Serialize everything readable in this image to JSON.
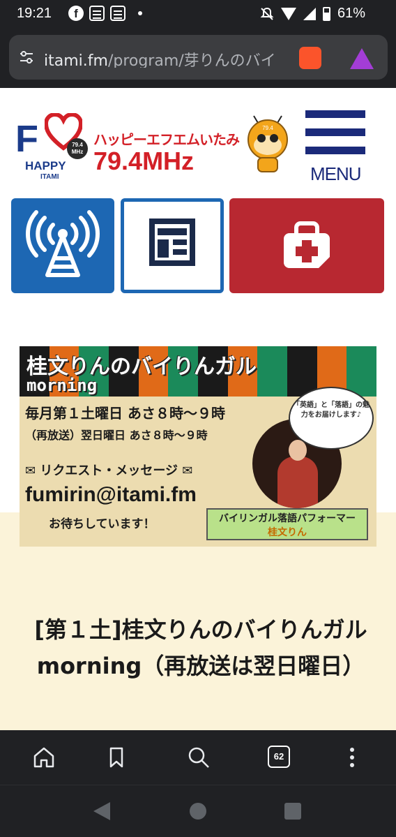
{
  "status": {
    "time": "19:21",
    "battery": "61%",
    "facebook_glyph": "f"
  },
  "browser": {
    "url_domain": "itami.fm",
    "url_path": "/program/芽りんのバイ"
  },
  "site": {
    "logo_letter": "F",
    "logo_happy": "HAPPY",
    "logo_itami": "ITAMI",
    "logo_badge": "79.4 MHz",
    "station_name": "ハッピーエフエムいたみ",
    "frequency": "79.4MHz",
    "mascot_badge": "79.4",
    "menu_label": "MENU",
    "tiles": [
      {
        "name": "radio-tower-icon"
      },
      {
        "name": "news-layout-icon"
      },
      {
        "name": "first-aid-icon"
      }
    ]
  },
  "banner": {
    "title": "桂文りんのバイりんガル",
    "subtitle": "morning",
    "schedule1": "毎月第１土曜日 あさ８時～９時",
    "schedule2": "（再放送）翌日曜日 あさ８時～９時",
    "request": "リクエスト・メッセージ",
    "email": "fumirin@itami.fm",
    "waiting": "お待ちしています！",
    "bubble": "「英語」と「落語」の魅力をお届けします♪",
    "performer_role": "バイリンガル落語パフォーマー",
    "performer_name": "桂文りん",
    "stripe_colors": [
      "#1a1a1a",
      "#e06a18",
      "#1b8a5a",
      "#1a1a1a",
      "#e06a18",
      "#1b8a5a",
      "#1a1a1a",
      "#e06a18",
      "#1b8a5a",
      "#1a1a1a",
      "#e06a18",
      "#1b8a5a"
    ]
  },
  "program_title": "[第１土]桂文りんのバイりんガルmorning（再放送は翌日曜日）",
  "nav": {
    "tab_count": "62"
  }
}
